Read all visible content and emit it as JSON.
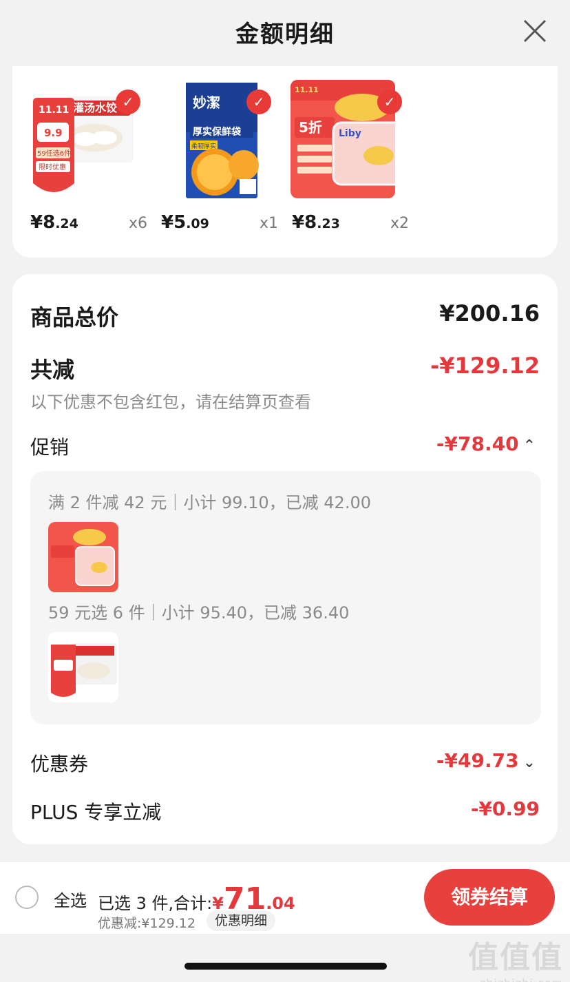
{
  "header": {
    "title": "金额明细",
    "close_icon": "close-icon"
  },
  "products": [
    {
      "name_text": "灌汤水饺",
      "badge": "11.11",
      "price_int": "¥8",
      "price_dec": ".24",
      "qty": "x6",
      "tag1": "59任选6件",
      "tag2": "限时优惠",
      "price_tag": "9.9"
    },
    {
      "name_text": "厚实保鲜袋",
      "brand": "妙潔",
      "sub": "柔韧厚实",
      "price_int": "¥5",
      "price_dec": ".09",
      "qty": "x1"
    },
    {
      "name_text": "5折",
      "brand": "Liby",
      "badge": "11.11",
      "price_int": "¥8",
      "price_dec": ".23",
      "qty": "x2"
    }
  ],
  "summary": {
    "goods_total_label": "商品总价",
    "goods_total_value": "¥200.16",
    "reduce_label": "共减",
    "reduce_value": "-¥129.12",
    "reduce_note": "以下优惠不包含红包，请在结算页查看",
    "promo_label": "促销",
    "promo_value": "-¥78.40",
    "promo_items": [
      {
        "text": "满 2 件减 42 元｜小计 99.10，已减 42.00"
      },
      {
        "text": "59 元选 6 件｜小计 95.40，已减 36.40"
      }
    ],
    "coupon_label": "优惠券",
    "coupon_value": "-¥49.73",
    "plus_label": "PLUS 专享立减",
    "plus_value": "-¥0.99"
  },
  "bottom": {
    "select_all": "全选",
    "selected_info": "已选 3 件,合计:",
    "total_yen": "¥",
    "total_int": "71",
    "total_dec": ".04",
    "discount": "优惠减:¥129.12",
    "detail_button": "优惠明细",
    "checkout_button": "领券结算"
  },
  "watermark": {
    "logo": "值值值",
    "url": "zhizhizhi.com"
  },
  "colors": {
    "accent_red": "#e4393c",
    "button_red": "#e8413d",
    "background": "#f2f2f2"
  }
}
